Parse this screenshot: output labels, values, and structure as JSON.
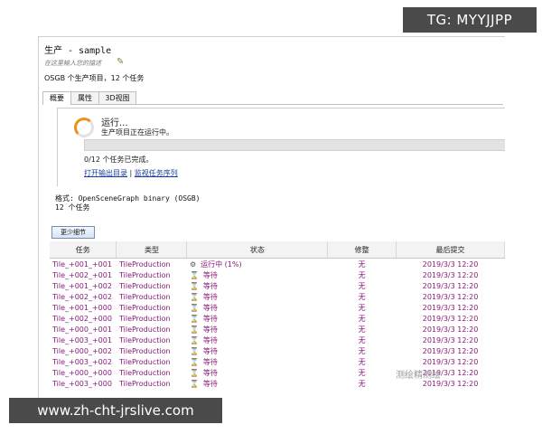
{
  "window": {
    "title": "生产 - sample",
    "description_placeholder": "在这里输入您的描述",
    "summary": "OSGB 个生产项目，12 个任务"
  },
  "tabs": [
    "概要",
    "属性",
    "3D视图"
  ],
  "run": {
    "title": "运行...",
    "subtitle": "生产项目正在运行中。",
    "progress": 0.0,
    "done_text": "0/12 个任务已完成。",
    "link_open": "打开输出目录",
    "link_sep": "|",
    "link_monitor": "监视任务序列"
  },
  "format": {
    "line1": "格式: OpenSceneGraph binary (OSGB)",
    "line2": "12 个任务"
  },
  "less_button": "更少细节",
  "table": {
    "headers": [
      "任务",
      "类型",
      "状态",
      "修整",
      "最后提交"
    ],
    "rows": [
      {
        "task": "Tile_+001_+001",
        "type": "TileProduction",
        "status": "运行中 (1%)",
        "icon": "gear-icon",
        "mod": "无",
        "date": "2019/3/3 12:20"
      },
      {
        "task": "Tile_+002_+001",
        "type": "TileProduction",
        "status": "等待",
        "icon": "hourglass-icon",
        "mod": "无",
        "date": "2019/3/3 12:20"
      },
      {
        "task": "Tile_+001_+002",
        "type": "TileProduction",
        "status": "等待",
        "icon": "hourglass-icon",
        "mod": "无",
        "date": "2019/3/3 12:20"
      },
      {
        "task": "Tile_+002_+002",
        "type": "TileProduction",
        "status": "等待",
        "icon": "hourglass-icon",
        "mod": "无",
        "date": "2019/3/3 12:20"
      },
      {
        "task": "Tile_+001_+000",
        "type": "TileProduction",
        "status": "等待",
        "icon": "hourglass-icon",
        "mod": "无",
        "date": "2019/3/3 12:20"
      },
      {
        "task": "Tile_+002_+000",
        "type": "TileProduction",
        "status": "等待",
        "icon": "hourglass-icon",
        "mod": "无",
        "date": "2019/3/3 12:20"
      },
      {
        "task": "Tile_+000_+001",
        "type": "TileProduction",
        "status": "等待",
        "icon": "hourglass-icon",
        "mod": "无",
        "date": "2019/3/3 12:20"
      },
      {
        "task": "Tile_+003_+001",
        "type": "TileProduction",
        "status": "等待",
        "icon": "hourglass-icon",
        "mod": "无",
        "date": "2019/3/3 12:20"
      },
      {
        "task": "Tile_+000_+002",
        "type": "TileProduction",
        "status": "等待",
        "icon": "hourglass-icon",
        "mod": "无",
        "date": "2019/3/3 12:20"
      },
      {
        "task": "Tile_+003_+002",
        "type": "TileProduction",
        "status": "等待",
        "icon": "hourglass-icon",
        "mod": "无",
        "date": "2019/3/3 12:20"
      },
      {
        "task": "Tile_+000_+000",
        "type": "TileProduction",
        "status": "等待",
        "icon": "hourglass-icon",
        "mod": "无",
        "date": "2019/3/3 12:20"
      },
      {
        "task": "Tile_+003_+000",
        "type": "TileProduction",
        "status": "等待",
        "icon": "hourglass-icon",
        "mod": "无",
        "date": "2019/3/3 12:20"
      }
    ]
  },
  "overlays": {
    "tg": "TG: MYYJJPP",
    "url": "www.zh-cht-jrslive.com",
    "watermark": "测绘精测绘"
  },
  "colors": {
    "task_text": "#8a1a7a",
    "link": "#1a3c9a",
    "spinner": "#e8921a",
    "overlay_bg": "#4a4a4a"
  }
}
